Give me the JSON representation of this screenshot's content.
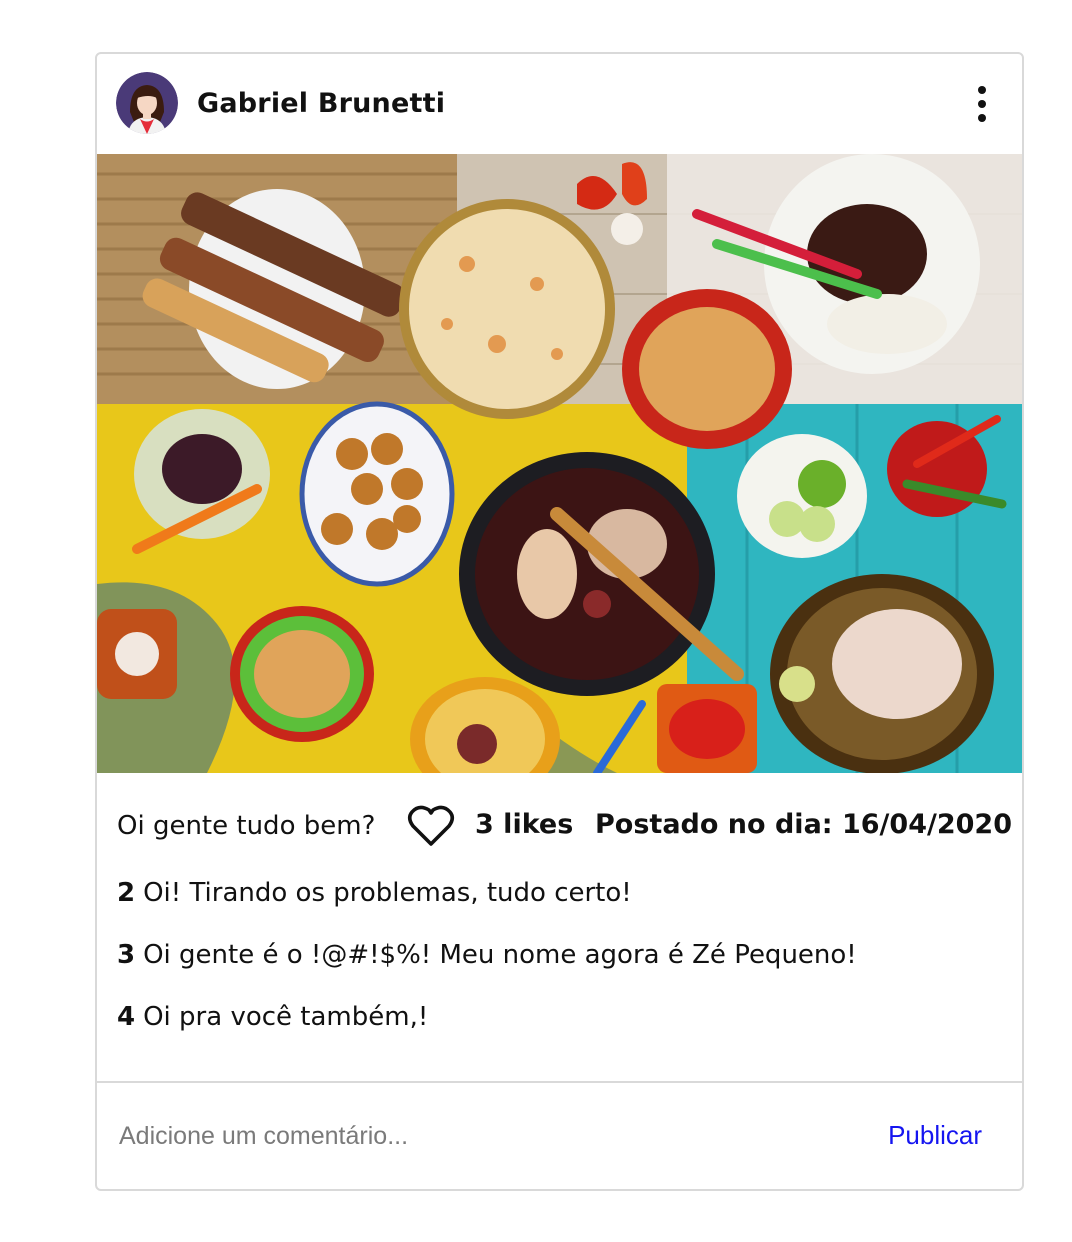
{
  "post": {
    "author": {
      "name": "Gabriel Brunetti",
      "avatar_icon": "woman-avatar-icon"
    },
    "menu_icon": "more-vertical-icon",
    "photo": {
      "description_icon": "food-photo"
    },
    "caption": "Oi gente tudo bem?",
    "like_icon": "heart-outline-icon",
    "likes": "3 likes",
    "posted": "Postado no dia: 16/04/2020",
    "comments": [
      {
        "user": "2",
        "text": "Oi! Tirando os problemas, tudo certo!"
      },
      {
        "user": "3",
        "text": "Oi gente é o !@#!$%! Meu nome agora é Zé Pequeno!"
      },
      {
        "user": "4",
        "text": "Oi pra você também,!"
      }
    ],
    "comment_box": {
      "placeholder": "Adicione um comentário...",
      "value": ""
    },
    "publish_label": "Publicar",
    "colors": {
      "publish": "#1515f0",
      "border": "#d9d9d9",
      "avatar_bg": "#4a3a78"
    }
  }
}
